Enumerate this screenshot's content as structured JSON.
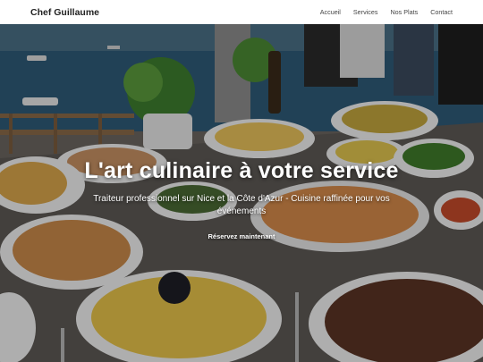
{
  "header": {
    "brand": "Chef Guillaume",
    "nav": [
      "Accueil",
      "Services",
      "Nos Plats",
      "Contact"
    ]
  },
  "hero": {
    "title": "L'art culinaire à votre service",
    "subtitle": "Traiteur professionnel sur Nice et la Côte d'Azur - Cuisine raffinée pour vos événements",
    "cta": "Réservez maintenant",
    "background": "photo of a catering buffet on a seaside terrace"
  },
  "colors": {
    "header_bg": "#ffffff",
    "brand_text": "#222222",
    "nav_text": "#444444",
    "hero_text": "#ffffff"
  }
}
